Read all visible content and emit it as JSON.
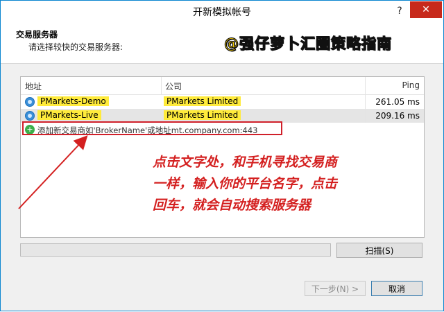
{
  "window": {
    "title": "开新模拟帐号",
    "help_glyph": "?",
    "close_glyph": "✕"
  },
  "header": {
    "title": "交易服务器",
    "subtitle": "请选择较快的交易服务器:",
    "banner": "@强仔萝卜汇圈策略指南"
  },
  "table": {
    "columns": [
      "地址",
      "公司",
      "Ping"
    ],
    "rows": [
      {
        "name": "PMarkets-Demo",
        "company": "PMarkets Limited",
        "ping": "261.05 ms",
        "selected": false
      },
      {
        "name": "PMarkets-Live",
        "company": "PMarkets Limited",
        "ping": "209.16 ms",
        "selected": true
      }
    ],
    "add_row_text": "添加新交易商如'BrokerName'或地址mt.company.com:443"
  },
  "annotation": {
    "lines": [
      "点击文字处，和手机寻找交易商",
      "一样，输入你的平台名字，点击",
      "回车，就会自动搜索服务器"
    ]
  },
  "buttons": {
    "scan": "扫描(S)",
    "next": "下一步(N) >",
    "cancel": "取消"
  },
  "colors": {
    "accent": "#0a85d0",
    "close": "#c7291b",
    "annotation": "#d42020",
    "highlight": "#ffeb3b"
  }
}
